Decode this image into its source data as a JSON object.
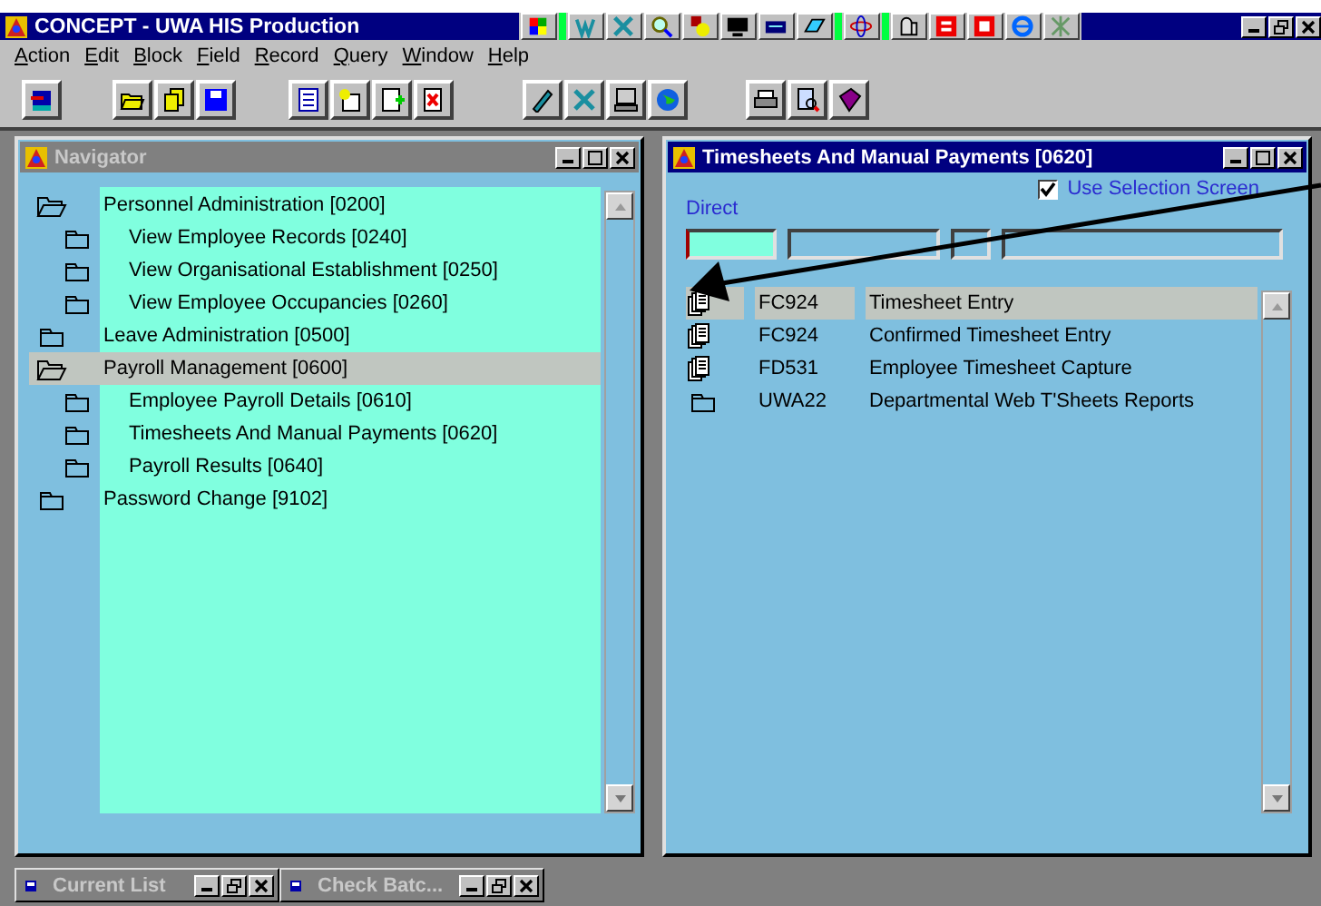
{
  "window": {
    "title": "CONCEPT - UWA HIS Production"
  },
  "menu": [
    "Action",
    "Edit",
    "Block",
    "Field",
    "Record",
    "Query",
    "Window",
    "Help"
  ],
  "navigator": {
    "title": "Navigator",
    "active": false,
    "tree": [
      {
        "label": "Personnel Administration [0200]",
        "expanded": true,
        "selected": false,
        "children": [
          {
            "label": "View Employee Records [0240]",
            "expanded": false,
            "selected": false
          },
          {
            "label": "View Organisational Establishment [0250]",
            "expanded": false,
            "selected": false
          },
          {
            "label": "View Employee Occupancies [0260]",
            "expanded": false,
            "selected": false
          }
        ]
      },
      {
        "label": "Leave Administration [0500]",
        "expanded": false,
        "selected": false
      },
      {
        "label": "Payroll Management [0600]",
        "expanded": true,
        "selected": true,
        "children": [
          {
            "label": "Employee Payroll Details [0610]",
            "expanded": false,
            "selected": false
          },
          {
            "label": "Timesheets And Manual Payments [0620]",
            "expanded": false,
            "selected": false
          },
          {
            "label": "Payroll Results [0640]",
            "expanded": false,
            "selected": false
          }
        ]
      },
      {
        "label": "Password Change [9102]",
        "expanded": false,
        "selected": false
      }
    ]
  },
  "timesheets": {
    "title": "Timesheets And Manual Payments [0620]",
    "active": true,
    "direct_label": "Direct",
    "use_selection_screen": {
      "label": "Use Selection Screen",
      "checked": true
    },
    "fields": [
      {
        "focused": true
      },
      {
        "focused": false
      },
      {
        "focused": false
      },
      {
        "focused": false
      }
    ],
    "rows": [
      {
        "kind": "form",
        "code": "FC924",
        "label": "Timesheet Entry",
        "selected": true
      },
      {
        "kind": "form",
        "code": "FC924",
        "label": "Confirmed Timesheet Entry",
        "selected": false
      },
      {
        "kind": "form",
        "code": "FD531",
        "label": "Employee Timesheet Capture",
        "selected": false
      },
      {
        "kind": "folder",
        "code": "UWA22",
        "label": "Departmental Web T'Sheets Reports",
        "selected": false
      }
    ]
  },
  "minimized_windows": [
    {
      "title": "Current List"
    },
    {
      "title": "Check Batc..."
    }
  ]
}
